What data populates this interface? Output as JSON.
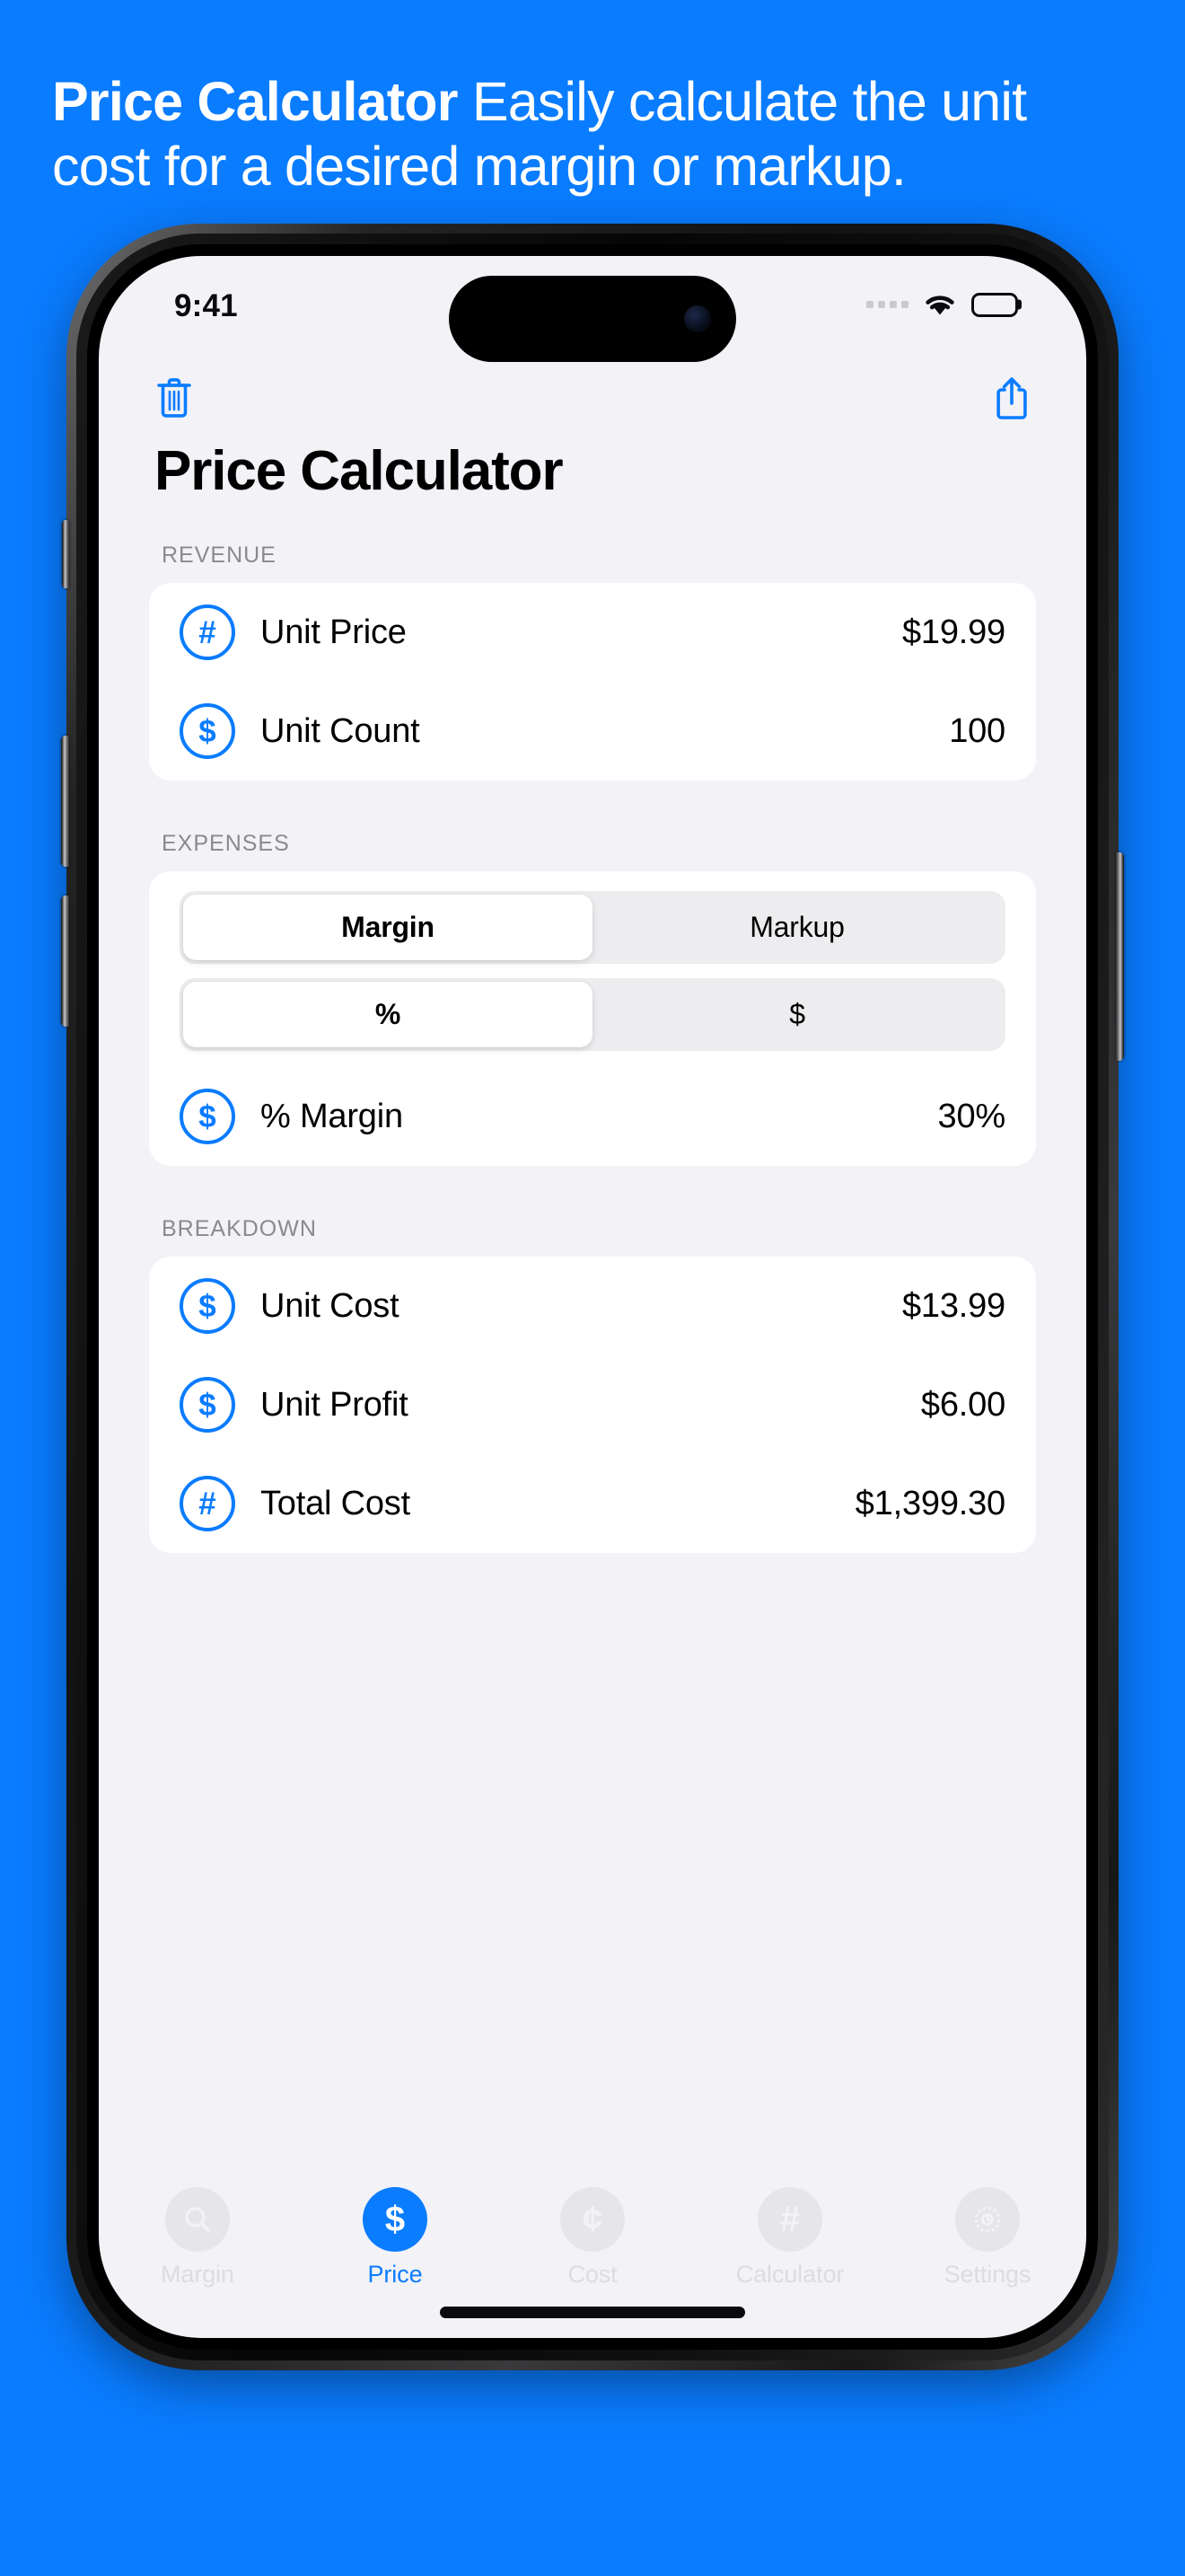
{
  "theme": {
    "background": "#0A7CFF",
    "accent": "#0A7CFF",
    "screen_bg": "#F2F2F7",
    "card_bg": "#FFFFFF",
    "section_header_color": "#8A8A8E"
  },
  "marketing": {
    "headline_bold": "Price Calculator",
    "headline_rest": " Easily calculate the unit cost for a desired margin or markup."
  },
  "status_bar": {
    "time": "9:41",
    "cellular_icon": "cellular-dots-icon",
    "wifi_icon": "wifi-icon",
    "battery_icon": "battery-full-icon"
  },
  "toolbar": {
    "delete_icon": "trash-icon",
    "share_icon": "share-icon"
  },
  "page_title": "Price Calculator",
  "sections": [
    {
      "header": "REVENUE",
      "rows": [
        {
          "icon": "#",
          "icon_name": "hash-circle-icon",
          "label": "Unit Price",
          "value": "$19.99"
        },
        {
          "icon": "$",
          "icon_name": "dollar-circle-icon",
          "label": "Unit Count",
          "value": "100"
        }
      ]
    },
    {
      "header": "EXPENSES",
      "segmented": [
        {
          "name": "margin-markup-segment",
          "options": [
            "Margin",
            "Markup"
          ],
          "selected": "Margin"
        },
        {
          "name": "percent-dollar-segment",
          "options": [
            "%",
            "$"
          ],
          "selected": "%"
        }
      ],
      "rows": [
        {
          "icon": "$",
          "icon_name": "dollar-circle-icon",
          "label": "% Margin",
          "value": "30%"
        }
      ]
    },
    {
      "header": "BREAKDOWN",
      "rows": [
        {
          "icon": "$",
          "icon_name": "dollar-circle-icon",
          "label": "Unit Cost",
          "value": "$13.99"
        },
        {
          "icon": "$",
          "icon_name": "dollar-circle-icon",
          "label": "Unit Profit",
          "value": "$6.00"
        },
        {
          "icon": "#",
          "icon_name": "hash-circle-icon",
          "label": "Total Cost",
          "value": "$1,399.30"
        }
      ]
    }
  ],
  "tabbar": {
    "items": [
      {
        "label": "Margin",
        "icon": "search-icon",
        "glyph": "",
        "active": false
      },
      {
        "label": "Price",
        "icon": "dollar-icon",
        "glyph": "$",
        "active": true
      },
      {
        "label": "Cost",
        "icon": "cent-icon",
        "glyph": "¢",
        "active": false
      },
      {
        "label": "Calculator",
        "icon": "hash-icon",
        "glyph": "#",
        "active": false
      },
      {
        "label": "Settings",
        "icon": "gear-icon",
        "glyph": "",
        "active": false
      }
    ]
  }
}
